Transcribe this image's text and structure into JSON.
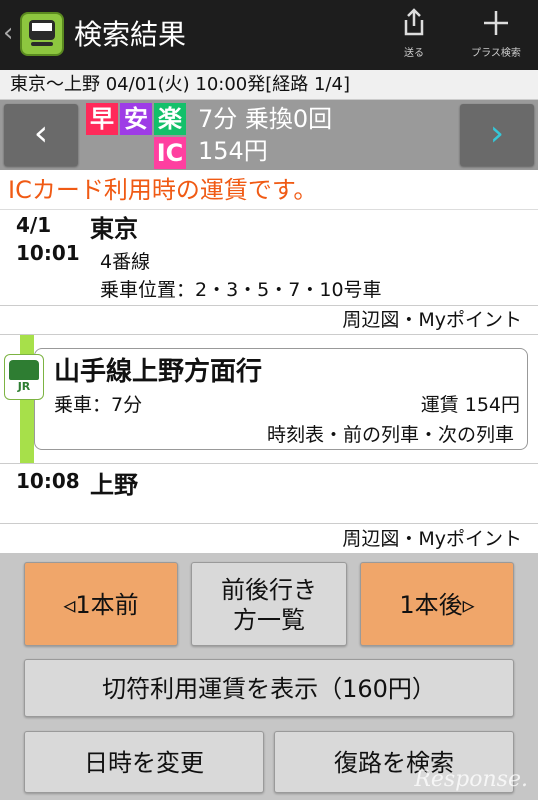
{
  "header": {
    "back_glyph": "‹",
    "title": "検索結果",
    "send_label": "送る",
    "plus_label": "プラス検索"
  },
  "route": {
    "line": "東京〜上野 04/01(火) 10:00発[経路 1/4]"
  },
  "summary": {
    "tags": [
      "早",
      "安",
      "楽",
      "IC"
    ],
    "time_transfers": "7分 乗換0回",
    "fare": "154円"
  },
  "notice": "ICカード利用時の運賃です。",
  "departure": {
    "date": "4/1",
    "time": "10:01",
    "station": "東京",
    "platform": "4番線",
    "car_position": "乗車位置：2・3・5・7・10号車",
    "links": "周辺図・Myポイント"
  },
  "segment": {
    "badge": "JR",
    "line_name": "山手線上野方面行",
    "ride_time": "乗車：7分",
    "fare": "運賃 154円",
    "links": "時刻表・前の列車・次の列車"
  },
  "arrival": {
    "time": "10:08",
    "station": "上野",
    "links": "周辺図・Myポイント"
  },
  "buttons": {
    "prev": "◃1本前",
    "list_line1": "前後行き",
    "list_line2": "方一覧",
    "next": "1本後▹",
    "ticket_fare": "切符利用運賃を表示（160円）",
    "change_datetime": "日時を変更",
    "return_search": "復路を検索"
  },
  "watermark": "Response.",
  "colors": {
    "orange_button": "#f0a66a",
    "notice_text": "#f05a14",
    "line_green": "#a7e04a"
  }
}
